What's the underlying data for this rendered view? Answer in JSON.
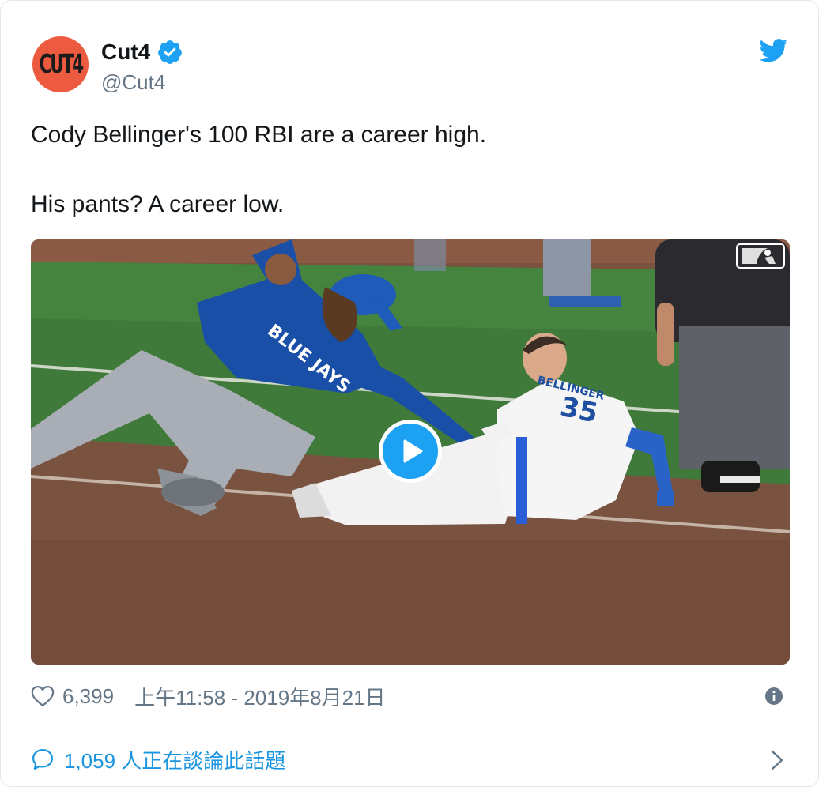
{
  "user": {
    "display_name": "Cut4",
    "handle": "@Cut4",
    "avatar_text": "CUT4",
    "verified": true,
    "icons": {
      "verified": "verified-badge-icon",
      "brand": "twitter-bird-icon"
    }
  },
  "tweet": {
    "text": "Cody Bellinger's 100 RBI are a career high.\n\nHis pants? A career low."
  },
  "media": {
    "type": "video",
    "play_icon": "play-icon",
    "watermark_icon": "mlb-logo-icon",
    "jersey_text": "BLUE JAYS",
    "jersey_number": "35",
    "jersey_name": "BELLINGER"
  },
  "footer": {
    "likes": "6,399",
    "timestamp": "上午11:58 - 2019年8月21日",
    "like_icon": "heart-icon",
    "info_icon": "info-icon"
  },
  "conversation": {
    "label": "1,059 人正在談論此話題",
    "bubble_icon": "speech-bubble-icon",
    "chevron_icon": "chevron-right-icon"
  },
  "colors": {
    "accent": "#1da1f2",
    "link": "#1b95e0",
    "avatar_bg": "#ec5a40",
    "text": "#14171a",
    "secondary": "#657786"
  }
}
